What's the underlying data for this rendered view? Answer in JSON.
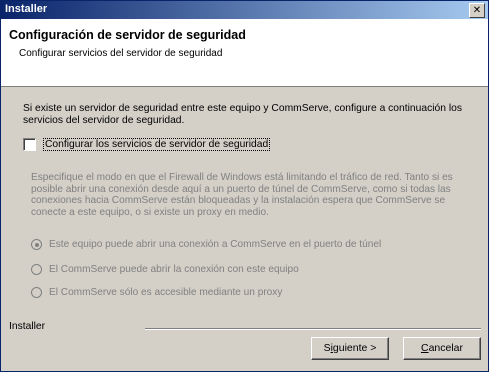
{
  "window": {
    "title": "Installer",
    "close_glyph": "✕"
  },
  "header": {
    "title": "Configuración de servidor de seguridad",
    "subtitle": "Configurar servicios del servidor de seguridad"
  },
  "intro": {
    "text": "Si existe un servidor de seguridad entre este equipo y CommServe, configure a continuación los servicios del servidor de seguridad."
  },
  "checkbox": {
    "label": "Configurar los servicios de servidor de seguridad",
    "checked": false
  },
  "firewall": {
    "text": "Especifique el modo en que el Firewall de Windows está limitando el tráfico de red. Tanto si es posible abrir una conexión desde aquí a un puerto de túnel de CommServe, como si todas las conexiones hacia CommServe están bloqueadas y la instalación espera que CommServe se conecte a este equipo, o si existe un proxy en medio."
  },
  "radios": [
    {
      "label": "Este equipo puede abrir una conexión a CommServe en el puerto de túnel",
      "selected": true
    },
    {
      "label": "El CommServe puede abrir la conexión con este equipo",
      "selected": false
    },
    {
      "label": "El CommServe sólo es accesible mediante un proxy",
      "selected": false
    }
  ],
  "footer": {
    "label": "Installer"
  },
  "buttons": {
    "next_pre": "S",
    "next_accel": "i",
    "next_post": "guiente >",
    "cancel_accel": "C",
    "cancel_post": "ancelar"
  }
}
